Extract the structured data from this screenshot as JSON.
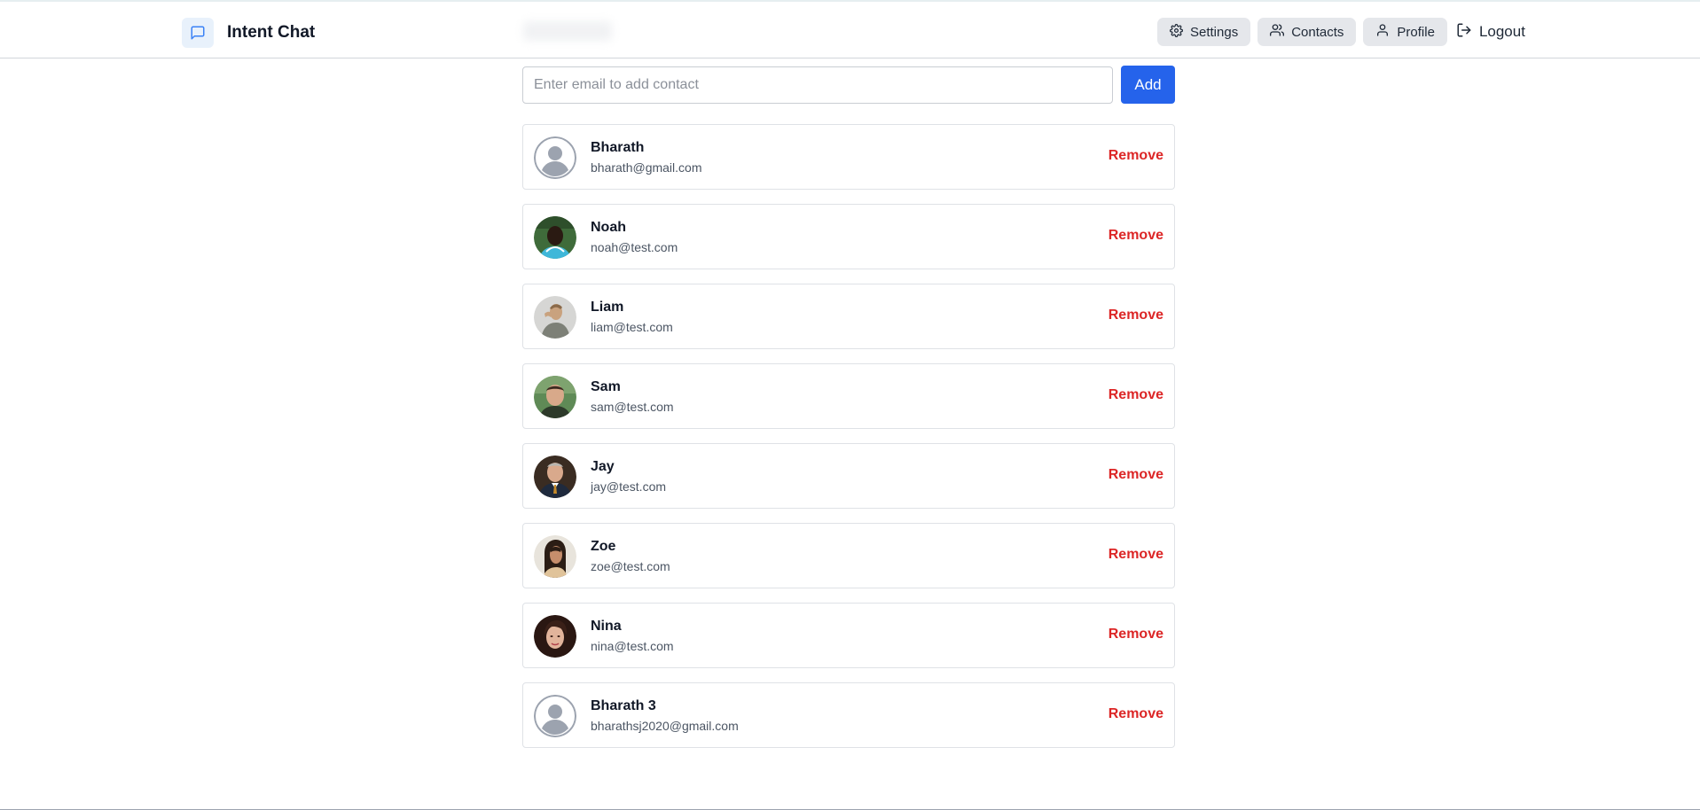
{
  "header": {
    "title": "Intent Chat",
    "nav": {
      "settings": "Settings",
      "contacts": "Contacts",
      "profile": "Profile",
      "logout": "Logout"
    }
  },
  "add_contact": {
    "placeholder": "Enter email to add contact",
    "button": "Add"
  },
  "contacts": [
    {
      "name": "Bharath",
      "email": "bharath@gmail.com",
      "avatar": "default-avatar-icon",
      "action": "Remove"
    },
    {
      "name": "Noah",
      "email": "noah@test.com",
      "avatar": "photo",
      "action": "Remove"
    },
    {
      "name": "Liam",
      "email": "liam@test.com",
      "avatar": "photo",
      "action": "Remove"
    },
    {
      "name": "Sam",
      "email": "sam@test.com",
      "avatar": "photo",
      "action": "Remove"
    },
    {
      "name": "Jay",
      "email": "jay@test.com",
      "avatar": "photo",
      "action": "Remove"
    },
    {
      "name": "Zoe",
      "email": "zoe@test.com",
      "avatar": "photo",
      "action": "Remove"
    },
    {
      "name": "Nina",
      "email": "nina@test.com",
      "avatar": "photo",
      "action": "Remove"
    },
    {
      "name": "Bharath 3",
      "email": "bharathsj2020@gmail.com",
      "avatar": "default-avatar-icon",
      "action": "Remove"
    }
  ],
  "colors": {
    "accent": "#2563eb",
    "danger": "#dc2626",
    "pill_bg": "#e5e7eb",
    "brand_icon": "#3b82f6"
  }
}
